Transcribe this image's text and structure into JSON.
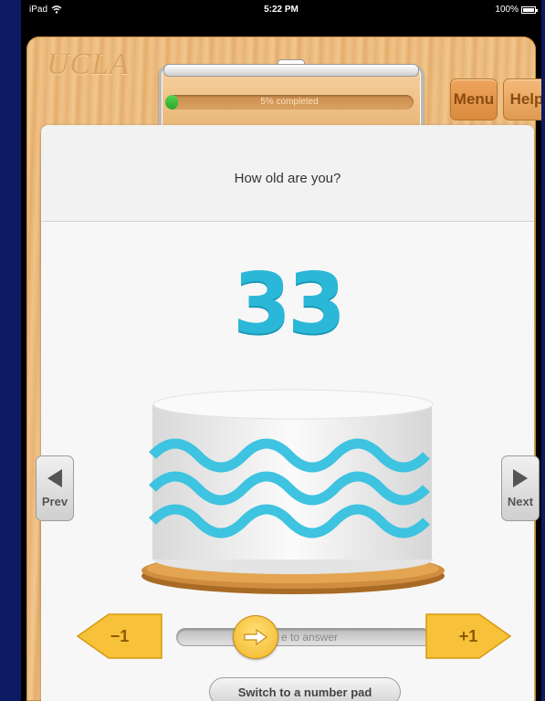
{
  "status_bar": {
    "device": "iPad",
    "time": "5:22 PM",
    "battery": "100%"
  },
  "header": {
    "logo_text": "UCLA",
    "progress_label": "5% completed",
    "progress_fraction": 0.05,
    "menu_label": "Menu",
    "help_label": "Help"
  },
  "question": {
    "text": "How old are you?",
    "answer_value": "33"
  },
  "navigation": {
    "prev_label": "Prev",
    "next_label": "Next"
  },
  "controls": {
    "minus_label": "−1",
    "plus_label": "+1",
    "slider_hint": "e to answer",
    "switch_label": "Switch to a number pad"
  },
  "colors": {
    "accent_cyan": "#2bb8d8",
    "progress_green": "#3bbf3a",
    "button_yellow": "#f7c23a",
    "wood": "#e9b87a"
  }
}
